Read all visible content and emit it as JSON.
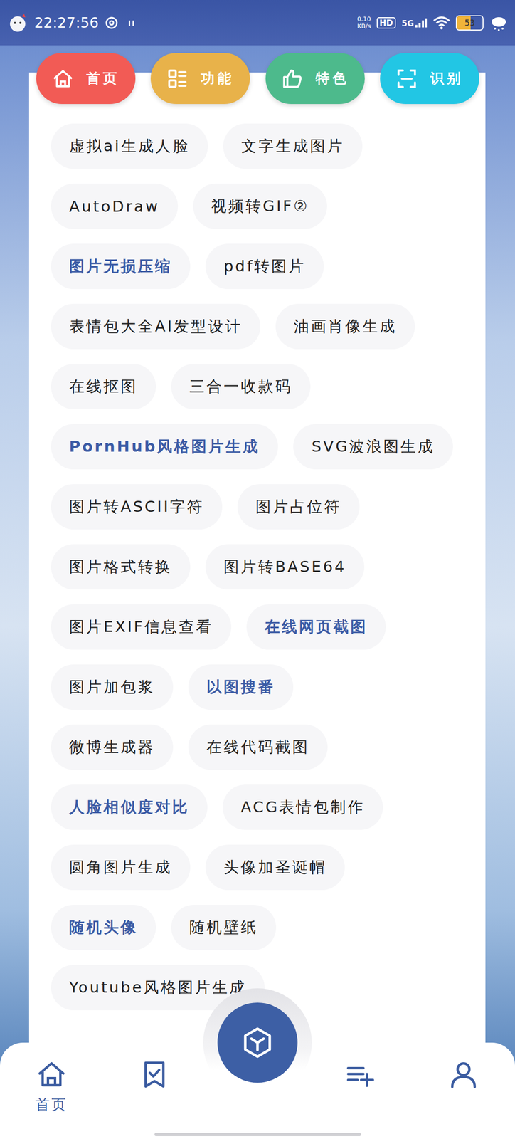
{
  "status_bar": {
    "time": "22:27:56",
    "net_speed": "0.10",
    "net_unit": "KB/s",
    "hd": "HD",
    "signal": "5G",
    "battery": "53",
    "battery_level": 0.53
  },
  "top_nav": [
    {
      "label": "首页",
      "kind": "home",
      "color": "#f25b55"
    },
    {
      "label": "功能",
      "kind": "grid",
      "color": "#e8b24a"
    },
    {
      "label": "特色",
      "kind": "thumb",
      "color": "#4dba8c"
    },
    {
      "label": "识别",
      "kind": "scan",
      "color": "#22c6e4"
    }
  ],
  "tool_rows": [
    [
      {
        "label": "虚拟ai生成人脸",
        "highlighted": false
      },
      {
        "label": "文字生成图片",
        "highlighted": false
      }
    ],
    [
      {
        "label": "AutoDraw",
        "highlighted": false
      },
      {
        "label": "视频转GIF②",
        "highlighted": false
      }
    ],
    [
      {
        "label": "图片无损压缩",
        "highlighted": true
      },
      {
        "label": "pdf转图片",
        "highlighted": false
      }
    ],
    [
      {
        "label": "表情包大全AI发型设计",
        "highlighted": false
      },
      {
        "label": "油画肖像生成",
        "highlighted": false
      }
    ],
    [
      {
        "label": "在线抠图",
        "highlighted": false
      },
      {
        "label": "三合一收款码",
        "highlighted": false
      }
    ],
    [
      {
        "label": "PornHub风格图片生成",
        "highlighted": true
      },
      {
        "label": "SVG波浪图生成",
        "highlighted": false
      }
    ],
    [
      {
        "label": "图片转ASCII字符",
        "highlighted": false
      },
      {
        "label": "图片占位符",
        "highlighted": false
      }
    ],
    [
      {
        "label": "图片格式转换",
        "highlighted": false
      },
      {
        "label": "图片转BASE64",
        "highlighted": false
      }
    ],
    [
      {
        "label": "图片EXIF信息查看",
        "highlighted": false
      },
      {
        "label": "在线网页截图",
        "highlighted": true
      }
    ],
    [
      {
        "label": "图片加包浆",
        "highlighted": false
      },
      {
        "label": "以图搜番",
        "highlighted": true
      }
    ],
    [
      {
        "label": "微博生成器",
        "highlighted": false
      },
      {
        "label": "在线代码截图",
        "highlighted": false
      }
    ],
    [
      {
        "label": "人脸相似度对比",
        "highlighted": true
      },
      {
        "label": "ACG表情包制作",
        "highlighted": false
      }
    ],
    [
      {
        "label": "圆角图片生成",
        "highlighted": false
      },
      {
        "label": "头像加圣诞帽",
        "highlighted": false
      }
    ],
    [
      {
        "label": "随机头像",
        "highlighted": true
      },
      {
        "label": "随机壁纸",
        "highlighted": false
      }
    ],
    [
      {
        "label": "Youtube风格图片生成",
        "highlighted": false
      }
    ]
  ],
  "bottom_nav": [
    {
      "label": "首页",
      "kind": "home",
      "selected": true
    },
    {
      "label": "",
      "kind": "bookmark",
      "selected": false
    },
    {
      "label": "",
      "kind": "fab",
      "selected": false
    },
    {
      "label": "",
      "kind": "playlist",
      "selected": false
    },
    {
      "label": "",
      "kind": "user",
      "selected": false
    }
  ]
}
